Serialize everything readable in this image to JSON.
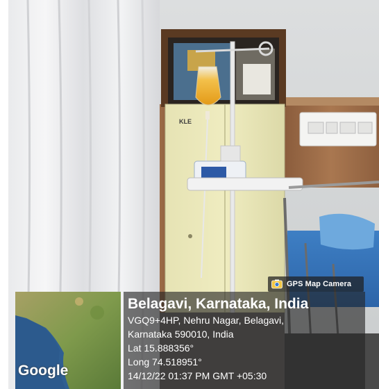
{
  "gps_badge": {
    "label": "GPS Map Camera",
    "icon": "map-camera-icon"
  },
  "location": {
    "title": "Belagavi, Karnataka, India",
    "address_line1": "VGQ9+4HP, Nehru Nagar, Belagavi,",
    "address_line2": "Karnataka 590010, India",
    "latitude": "Lat 15.888356°",
    "longitude": "Long 74.518951°",
    "timestamp": "14/12/22 01:37 PM GMT +05:30"
  },
  "map": {
    "attribution": "Google"
  },
  "signage": {
    "cabinet_logo": "KLE"
  }
}
